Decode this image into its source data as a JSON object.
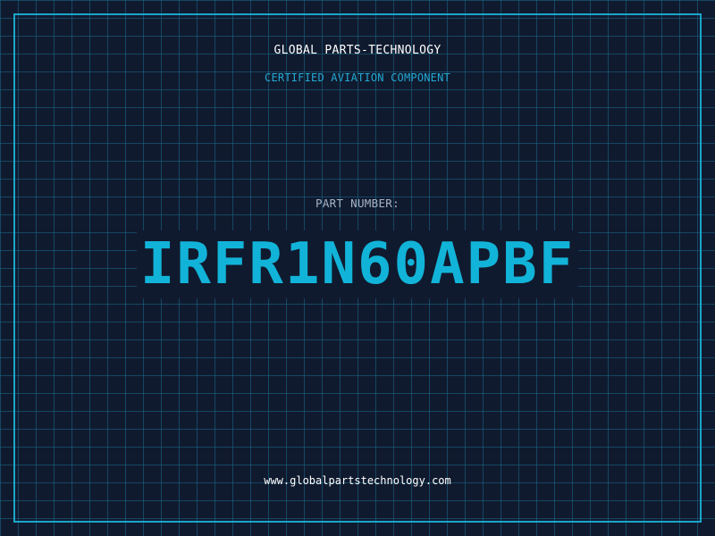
{
  "header": {
    "brand": "GLOBAL PARTS-TECHNOLOGY",
    "subtitle": "CERTIFIED AVIATION COMPONENT"
  },
  "main": {
    "part_label": "PART NUMBER:",
    "part_number": "IRFR1N60APBF"
  },
  "footer": {
    "website": "www.globalpartstechnology.com"
  },
  "colors": {
    "background": "#101a2e",
    "grid": "#1a6a8c",
    "frame": "#1ba6cc",
    "accent": "#12b3d8",
    "text": "#ffffff",
    "muted": "#a6b4c8"
  }
}
